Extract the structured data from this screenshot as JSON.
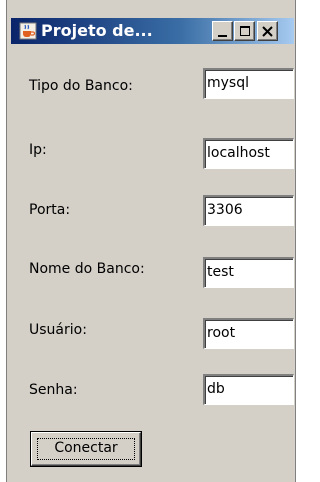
{
  "window": {
    "title": "Projeto de...",
    "icon": "java-cup-icon",
    "controls": [
      "minimize",
      "maximize",
      "close"
    ]
  },
  "form": {
    "fields": [
      {
        "label": "Tipo do Banco:",
        "value": "mysql"
      },
      {
        "label": "Ip:",
        "value": "localhost"
      },
      {
        "label": "Porta:",
        "value": "3306"
      },
      {
        "label": "Nome do Banco:",
        "value": "test"
      },
      {
        "label": "Usuário:",
        "value": "root"
      },
      {
        "label": "Senha:",
        "value": "db"
      }
    ],
    "connect_label": "Conectar"
  },
  "colors": {
    "window_bg": "#d4d0c8",
    "titlebar_start": "#0a246a",
    "titlebar_end": "#a6caf0"
  }
}
